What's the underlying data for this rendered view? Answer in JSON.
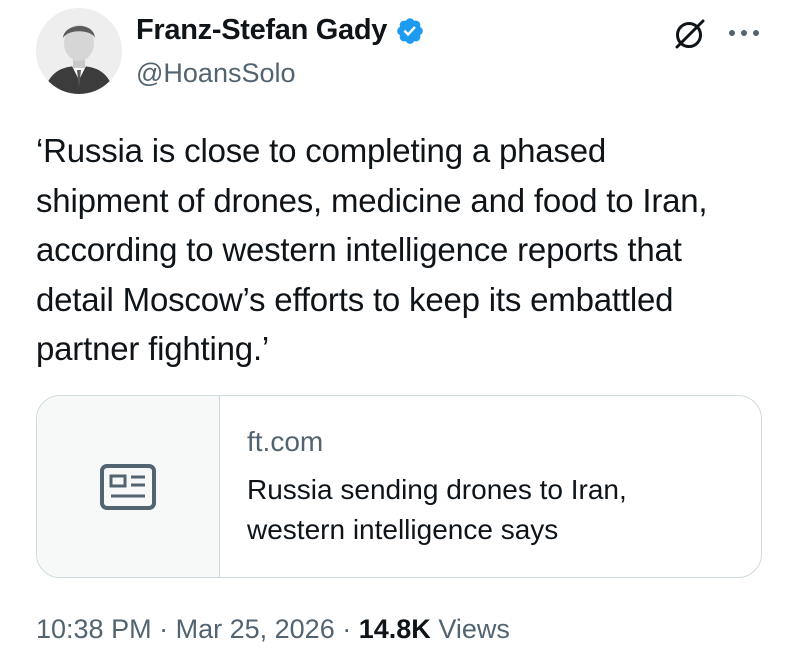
{
  "author": {
    "display_name": "Franz-Stefan Gady",
    "handle": "@HoansSolo",
    "verified": true
  },
  "tweet": {
    "text": "‘Russia is close to completing a phased\nshipment of drones, medicine and food to Iran,\naccording to western intelligence reports that\ndetail Moscow’s efforts to keep its embattled\npartner fighting.’"
  },
  "link_card": {
    "domain": "ft.com",
    "title": "Russia sending drones to Iran, western intelligence says",
    "icon": "article-icon"
  },
  "meta": {
    "time": "10:38 PM",
    "separator": "·",
    "date": "Mar 25, 2026",
    "views_count": "14.8K",
    "views_label": "Views"
  },
  "icons": {
    "verified": "verified-badge-icon",
    "grok": "grok-icon",
    "more": "more-options-icon"
  },
  "colors": {
    "text_primary": "#0f1419",
    "text_secondary": "#536471",
    "verified_blue": "#1d9bf0",
    "border": "#cfd9de"
  }
}
